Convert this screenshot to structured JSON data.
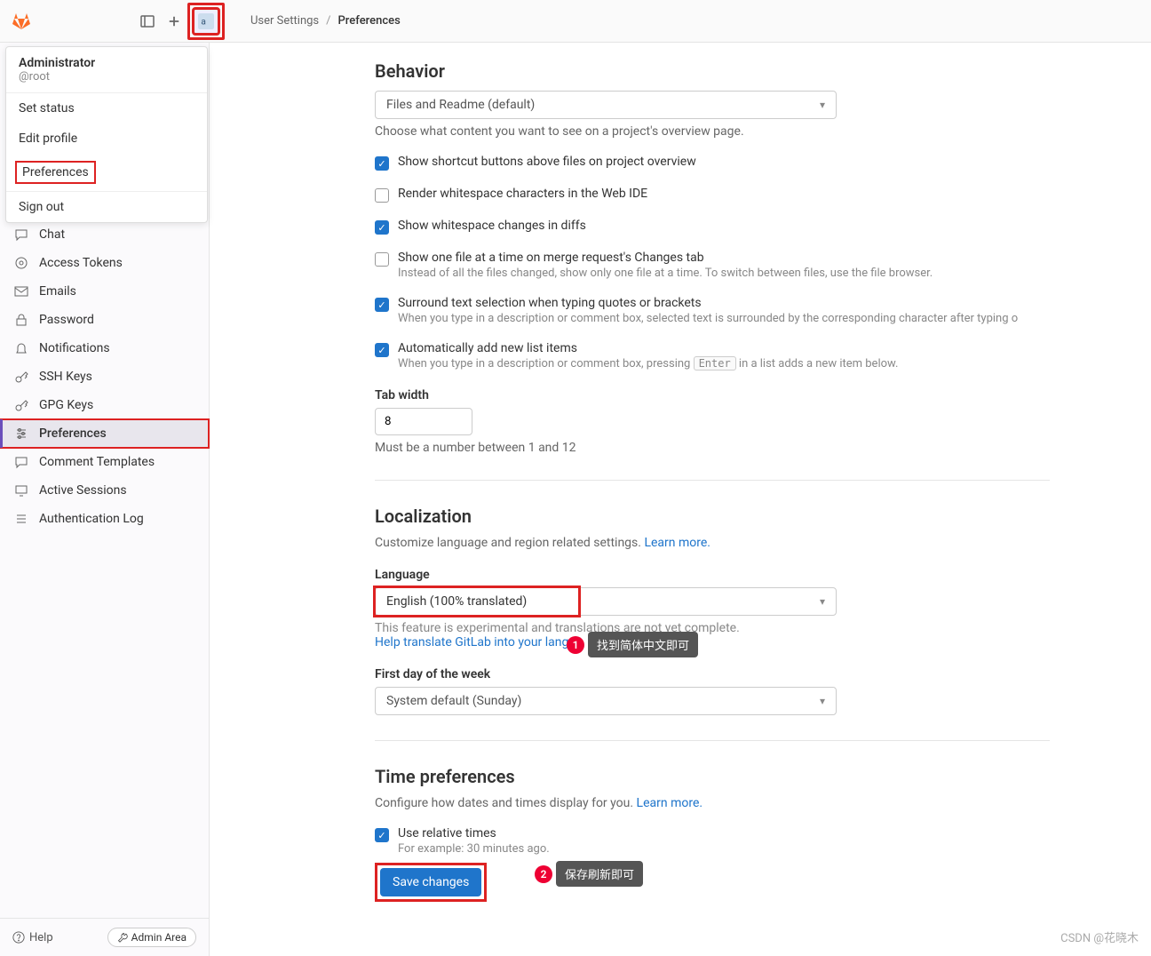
{
  "topbar": {
    "breadcrumb_user_settings": "User Settings",
    "breadcrumb_sep": "/",
    "breadcrumb_current": "Preferences"
  },
  "user_menu": {
    "name": "Administrator",
    "handle": "@root",
    "set_status": "Set status",
    "edit_profile": "Edit profile",
    "preferences": "Preferences",
    "sign_out": "Sign out"
  },
  "sidebar": {
    "items": [
      {
        "icon": "chat",
        "label": "Chat"
      },
      {
        "icon": "token",
        "label": "Access Tokens"
      },
      {
        "icon": "mail",
        "label": "Emails"
      },
      {
        "icon": "lock",
        "label": "Password"
      },
      {
        "icon": "bell",
        "label": "Notifications"
      },
      {
        "icon": "key",
        "label": "SSH Keys"
      },
      {
        "icon": "key",
        "label": "GPG Keys"
      },
      {
        "icon": "settings",
        "label": "Preferences"
      },
      {
        "icon": "comment",
        "label": "Comment Templates"
      },
      {
        "icon": "monitor",
        "label": "Active Sessions"
      },
      {
        "icon": "list",
        "label": "Authentication Log"
      }
    ],
    "help": "Help",
    "admin": "Admin Area"
  },
  "behavior": {
    "heading": "Behavior",
    "homepage_value": "Files and Readme (default)",
    "homepage_help": "Choose what content you want to see on a project's overview page.",
    "c1": "Show shortcut buttons above files on project overview",
    "c2": "Render whitespace characters in the Web IDE",
    "c3": "Show whitespace changes in diffs",
    "c4": "Show one file at a time on merge request's Changes tab",
    "c4_sub": "Instead of all the files changed, show only one file at a time. To switch between files, use the file browser.",
    "c5": "Surround text selection when typing quotes or brackets",
    "c5_sub": "When you type in a description or comment box, selected text is surrounded by the corresponding character after typing o",
    "c6": "Automatically add new list items",
    "c6_sub_pre": "When you type in a description or comment box, pressing ",
    "c6_kbd": "Enter",
    "c6_sub_post": " in a list adds a new item below.",
    "tab_label": "Tab width",
    "tab_value": "8",
    "tab_help": "Must be a number between 1 and 12"
  },
  "localization": {
    "heading": "Localization",
    "desc": "Customize language and region related settings. ",
    "learn_more": "Learn more.",
    "language_label": "Language",
    "language_value": "English (100% translated)",
    "exp": "This feature is experimental and translations are not yet complete.",
    "help_translate": "Help translate GitLab into your lang",
    "first_day_label": "First day of the week",
    "first_day_value": "System default (Sunday)"
  },
  "time": {
    "heading": "Time preferences",
    "desc": "Configure how dates and times display for you. ",
    "learn_more": "Learn more.",
    "c1": "Use relative times",
    "c1_sub": "For example: 30 minutes ago.",
    "save": "Save changes"
  },
  "annotations": {
    "a1": "找到简体中文即可",
    "a2": "保存刷新即可"
  },
  "watermark": "CSDN @花晓木"
}
